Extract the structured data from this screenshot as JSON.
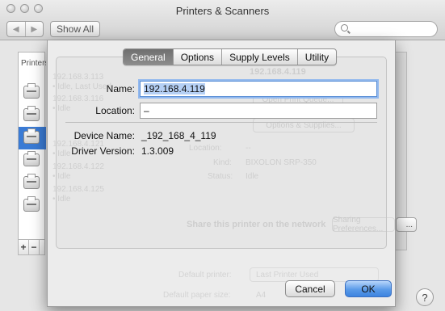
{
  "window": {
    "title": "Printers & Scanners",
    "nav_back": "◀",
    "nav_forward": "▶",
    "show_all_label": "Show All",
    "search_placeholder": ""
  },
  "sidebar": {
    "header": "Printers",
    "printers": [
      {
        "name": "192.168.3.113",
        "status": "• Idle, Last Used"
      },
      {
        "name": "192.168.3.116",
        "status": "• Idle"
      },
      {
        "name": "192.168.4.119",
        "status": ""
      },
      {
        "name": "192.168.4.121",
        "status": "• Idle"
      },
      {
        "name": "192.168.4.122",
        "status": "• Idle"
      },
      {
        "name": "192.168.4.125",
        "status": "• Idle"
      }
    ],
    "selected_index": 2,
    "add_label": "+",
    "remove_label": "−"
  },
  "background": {
    "printer_title": "192.168.4.119",
    "open_queue": "Open Print Queue...",
    "options_supplies": "Options & Supplies...",
    "location_label": "Location:",
    "location_value": "--",
    "kind_label": "Kind:",
    "kind_value": "BIXOLON SRP-350",
    "status_label": "Status:",
    "status_value": "Idle",
    "share_label": "Share this printer on the network",
    "sharing_prefs": "Sharing Preferences...",
    "default_printer_label": "Default printer:",
    "default_printer_value": "Last Printer Used",
    "default_paper_label": "Default paper size:",
    "default_paper_value": "A4"
  },
  "sheet": {
    "tabs": [
      "General",
      "Options",
      "Supply Levels",
      "Utility"
    ],
    "active_tab": "General",
    "name_label": "Name:",
    "name_value": "192.168.4.119",
    "location_label": "Location:",
    "location_value": "–",
    "device_name_label": "Device Name:",
    "device_name_value": "_192_168_4_119",
    "driver_version_label": "Driver Version:",
    "driver_version_value": "1.3.009",
    "cancel_label": "Cancel",
    "ok_label": "OK"
  },
  "help_label": "?",
  "colors": {
    "selection": "#3a7bd5",
    "default_button": "#3d84e0",
    "focus_ring": "#93b9ee"
  }
}
